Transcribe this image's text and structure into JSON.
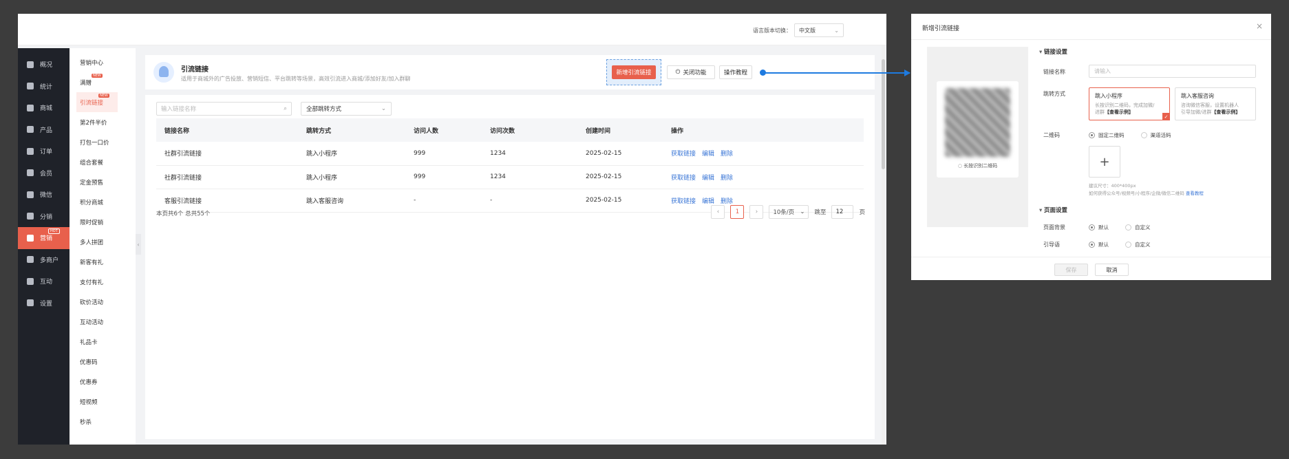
{
  "topbar": {
    "lang_label": "语言版本切换：",
    "lang_value": "中文版"
  },
  "sidebar": [
    {
      "label": "概况",
      "icon": "layers-icon"
    },
    {
      "label": "统计",
      "icon": "chart-icon"
    },
    {
      "label": "商城",
      "icon": "shop-icon"
    },
    {
      "label": "产品",
      "icon": "grid-icon"
    },
    {
      "label": "订单",
      "icon": "order-icon"
    },
    {
      "label": "会员",
      "icon": "crown-icon"
    },
    {
      "label": "微信",
      "icon": "wechat-icon"
    },
    {
      "label": "分销",
      "icon": "user-icon"
    },
    {
      "label": "营销",
      "icon": "flag-icon",
      "active": true,
      "badge": "HOT"
    },
    {
      "label": "多商户",
      "icon": "store-icon"
    },
    {
      "label": "互动",
      "icon": "interact-icon"
    },
    {
      "label": "设置",
      "icon": "gear-icon"
    }
  ],
  "subnav": [
    {
      "label": "营销中心"
    },
    {
      "label": "满赠",
      "badge": "NEW"
    },
    {
      "label": "引流链接",
      "active": true,
      "badge": "NEW"
    },
    {
      "label": "第2件半价"
    },
    {
      "label": "打包一口价"
    },
    {
      "label": "组合套餐"
    },
    {
      "label": "定金预售"
    },
    {
      "label": "积分商城"
    },
    {
      "label": "限时促销"
    },
    {
      "label": "多人拼团"
    },
    {
      "label": "新客有礼"
    },
    {
      "label": "支付有礼"
    },
    {
      "label": "砍价活动"
    },
    {
      "label": "互动活动"
    },
    {
      "label": "礼品卡"
    },
    {
      "label": "优惠码"
    },
    {
      "label": "优惠券"
    },
    {
      "label": "短视频"
    },
    {
      "label": "秒杀"
    }
  ],
  "header": {
    "title": "引流链接",
    "desc": "适用于商城外的广告投放、营销短信、平台跳转等场景，高效引流进入商城/添加好友/加入群聊",
    "new_btn": "新增引流链接",
    "toggle_btn": "关闭功能",
    "tutorial_btn": "操作教程"
  },
  "filters": {
    "search_placeholder": "输入链接名称",
    "jump_select": "全部跳转方式"
  },
  "table": {
    "columns": [
      "链接名称",
      "跳转方式",
      "访问人数",
      "访问次数",
      "创建时间",
      "操作"
    ],
    "rows": [
      {
        "name": "社群引流链接",
        "jump": "跳入小程序",
        "visitors": "999",
        "visits": "1234",
        "created": "2025-02-15"
      },
      {
        "name": "社群引流链接",
        "jump": "跳入小程序",
        "visitors": "999",
        "visits": "1234",
        "created": "2025-02-15"
      },
      {
        "name": "客服引流链接",
        "jump": "跳入客服咨询",
        "visitors": "-",
        "visits": "-",
        "created": "2025-02-15"
      }
    ],
    "actions": [
      "获取链接",
      "编辑",
      "删除"
    ]
  },
  "pager": {
    "info": "本页共6个  总共55个",
    "current": "1",
    "size": "10条/页",
    "jump_label": "跳至",
    "jump_value": "12",
    "page_unit": "页"
  },
  "modal": {
    "title": "新增引流链接",
    "preview_tip": "长按识别二维码",
    "section_link": "链接设置",
    "name_label": "链接名称",
    "name_placeholder": "请输入",
    "jump_label": "跳转方式",
    "jump_options": [
      {
        "title": "跳入小程序",
        "desc1": "长按识别二维码，完成加微/",
        "desc2": "进群",
        "link": "【查看示例】",
        "selected": true
      },
      {
        "title": "跳入客服咨询",
        "desc1": "咨询微信客服，设置机器人",
        "desc2": "引导加微/进群",
        "link": "【查看示例】",
        "selected": false
      }
    ],
    "qr_label": "二维码",
    "qr_options": [
      "固定二维码",
      "渠道活码"
    ],
    "qr_hint1": "建议尺寸：400*400px",
    "qr_hint2": "如何获得公众号/视频号/小程序/企微/微信二维码",
    "qr_hint_link": "查看教程",
    "section_page": "页面设置",
    "bg_label": "页面背景",
    "guide_label": "引导语",
    "default_opt": "默认",
    "custom_opt": "自定义",
    "save_btn": "保存",
    "cancel_btn": "取消"
  },
  "colors": {
    "accent": "#e8604c",
    "link": "#3a76d6",
    "sidebar_bg": "#1f2229",
    "connector": "#1e7be0"
  }
}
